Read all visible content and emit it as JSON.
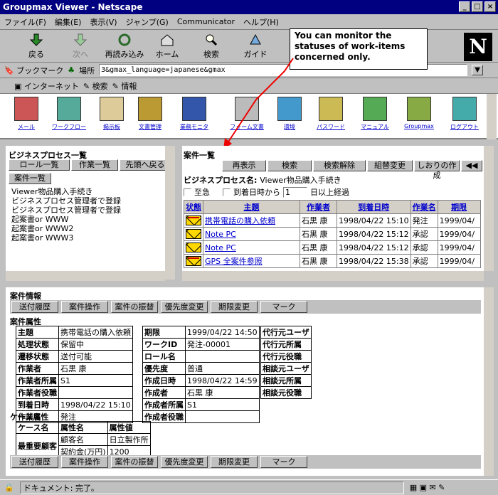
{
  "window": {
    "title": "Groupmax Viewer - Netscape"
  },
  "menu": [
    "ファイル(F)",
    "編集(E)",
    "表示(V)",
    "ジャンプ(G)",
    "Communicator",
    "ヘルプ(H)"
  ],
  "nav": {
    "back": "戻る",
    "forward": "次へ",
    "reload": "再読み込み",
    "home": "ホーム",
    "search": "検索",
    "guide": "ガイド"
  },
  "location": {
    "bookmarks": "ブックマーク",
    "label": "場所",
    "url": "3&gmax_language=japanese&gmax"
  },
  "personal": [
    "インターネット",
    "検索",
    "情報"
  ],
  "apps": [
    "メール",
    "ワークフロー",
    "掲示板",
    "文書管理",
    "業務モニタ",
    "フォーム文書",
    "環境",
    "パスワード",
    "マニュアル",
    "Groupmax",
    "ログアウト"
  ],
  "callout": "You can monitor the statuses of work-items concerned only.",
  "left": {
    "title": "ビジネスプロセス一覧",
    "tabs": [
      "ロール一覧",
      "作業一覧",
      "先頭へ戻る"
    ],
    "case_button": "案件一覧",
    "items": [
      "Viewer物品購入手続き",
      "ビジネスプロセス管理者で登録",
      "ビジネスプロセス管理者で登録",
      "起案書or WWW",
      "起案書or WWW2",
      "起案書or WWW3"
    ]
  },
  "right": {
    "title": "案件一覧",
    "buttons": [
      "再表示",
      "検索",
      "検索解除",
      "組替変更",
      "しおりの作成"
    ],
    "process_label": "ビジネスプロセス名:",
    "process_value": "Viewer物品購入手続き",
    "urgent": "至急",
    "arrival_label": "到着日時から",
    "days": "1",
    "days_suffix": "日以上経過",
    "headers": [
      "状態",
      "主題",
      "作業者",
      "到着日時",
      "作業名",
      "期限"
    ],
    "rows": [
      {
        "state": "red",
        "subject": "携帯電話の購入依頼",
        "worker": "石黒 康",
        "arrived": "1998/04/22 15:10",
        "task": "発注",
        "due": "1999/04/"
      },
      {
        "state": "yellow",
        "subject": "Note PC",
        "worker": "石黒 康",
        "arrived": "1998/04/22 15:12",
        "task": "承認",
        "due": "1999/04/"
      },
      {
        "state": "yellow",
        "subject": "Note PC",
        "worker": "石黒 康",
        "arrived": "1998/04/22 15:12",
        "task": "承認",
        "due": "1999/04/"
      },
      {
        "state": "red",
        "subject": "GPS 全案件参照",
        "worker": "石黒 康",
        "arrived": "1998/04/22 15:38",
        "task": "承認",
        "due": "1999/04/"
      }
    ]
  },
  "detail": {
    "case_info": "案件情報",
    "buttons": [
      "送付履歴",
      "案件操作",
      "案件の振替",
      "優先度変更",
      "期限変更",
      "マーク"
    ],
    "case_attr": "案件属性",
    "col1": [
      [
        "主題",
        "携帯電話の購入依頼"
      ],
      [
        "処理状態",
        "保留中"
      ],
      [
        "遷移状態",
        "送付可能"
      ],
      [
        "作業者",
        "石黒 康"
      ],
      [
        "作業者所属",
        "S1"
      ],
      [
        "作業者役職",
        ""
      ],
      [
        "到着日時",
        "1998/04/22 15:10"
      ],
      [
        "作業名",
        "発注"
      ]
    ],
    "col2": [
      [
        "期限",
        "1999/04/22 14:50"
      ],
      [
        "ワークID",
        "発注-00001"
      ],
      [
        "ロール名",
        ""
      ],
      [
        "優先度",
        "普通"
      ],
      [
        "作成日時",
        "1998/04/22 14:59"
      ],
      [
        "作成者",
        "石黒 康"
      ],
      [
        "作成者所属",
        "S1"
      ],
      [
        "作成者役職",
        ""
      ]
    ],
    "col3": [
      "代行元ユーザ",
      "代行元所属",
      "代行元役職",
      "相談元ユーザ",
      "相談元所属",
      "相談元役職"
    ],
    "case_props": "ケース属性",
    "prop_headers": [
      "ケース名",
      "属性名",
      "属性値"
    ],
    "prop_case": "最重要顧客",
    "props": [
      [
        "顧客名",
        "日立製作所"
      ],
      [
        "契約金(万円)",
        "1200"
      ]
    ]
  },
  "status": {
    "text": "ドキュメント: 完了。"
  }
}
